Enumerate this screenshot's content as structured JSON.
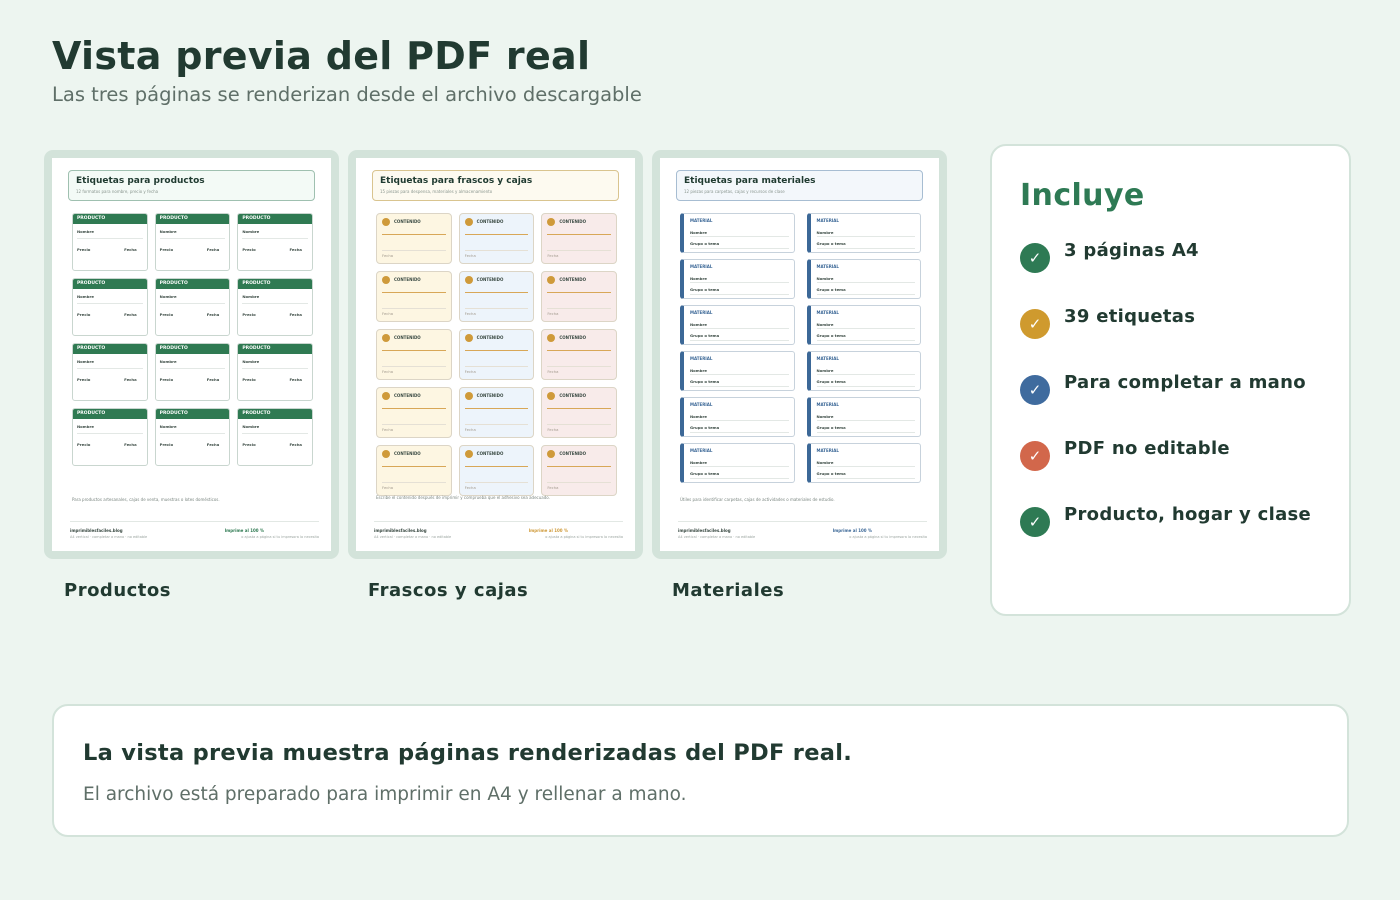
{
  "header": {
    "title": "Vista previa del PDF real",
    "subtitle": "Las tres páginas se renderizan desde el archivo descargable"
  },
  "previews": [
    {
      "caption": "Productos",
      "page_title": "Etiquetas para productos",
      "page_subtitle": "12 formatos para nombre, precio y fecha",
      "label_type": "PRODUCTO",
      "fields": [
        "Nombre",
        "Precio",
        "Fecha"
      ],
      "note": "Para productos artesanales, cajas de venta, muestras o lotes domésticos.",
      "footer_site": "imprimiblesfaciles.blog",
      "footer_site_sub": "A4 vertical · completar a mano · no editable",
      "footer_print": "Imprime al 100 %",
      "footer_print_sub": "o ajusta a página si tu impresora lo necesita",
      "accent": "#2f7a52"
    },
    {
      "caption": "Frascos y cajas",
      "page_title": "Etiquetas para frascos y cajas",
      "page_subtitle": "15 piezas para despensa, materiales y almacenamiento",
      "label_type": "CONTENIDO",
      "fields": [
        "Fecha"
      ],
      "note": "Escribe el contenido después de imprimir y comprueba que el adhesivo sea adecuado.",
      "footer_site": "imprimiblesfaciles.blog",
      "footer_site_sub": "A4 vertical · completar a mano · no editable",
      "footer_print": "Imprime al 100 %",
      "footer_print_sub": "o ajusta a página si tu impresora lo necesita",
      "accent": "#cf9a3a",
      "label_colors": [
        "#fdf6e2",
        "#edf4fb",
        "#f8ebea"
      ]
    },
    {
      "caption": "Materiales",
      "page_title": "Etiquetas para materiales",
      "page_subtitle": "12 piezas para carpetas, cajas y recursos de clase",
      "label_type": "MATERIAL",
      "fields": [
        "Nombre",
        "Grupo o tema"
      ],
      "note": "Útiles para identificar carpetas, cajas de actividades o materiales de estudio.",
      "footer_site": "imprimiblesfaciles.blog",
      "footer_site_sub": "A4 vertical · completar a mano · no editable",
      "footer_print": "Imprime al 100 %",
      "footer_print_sub": "o ajusta a página si tu impresora lo necesita",
      "accent": "#3c6897"
    }
  ],
  "includes": {
    "title": "Incluye",
    "items": [
      {
        "label": "3 páginas A4",
        "icon": "check-icon",
        "color": "#2e7a54"
      },
      {
        "label": "39 etiquetas",
        "icon": "check-icon",
        "color": "#cf9a2e"
      },
      {
        "label": "Para completar a mano",
        "icon": "check-icon",
        "color": "#3f6b9e"
      },
      {
        "label": "PDF no editable",
        "icon": "check-icon",
        "color": "#d2674b"
      },
      {
        "label": "Producto, hogar y clase",
        "icon": "check-icon",
        "color": "#2e7a54"
      }
    ]
  },
  "note": {
    "title": "La vista previa muestra páginas renderizadas del PDF real.",
    "text": "El archivo está preparado para imprimir en A4 y rellenar a mano."
  }
}
